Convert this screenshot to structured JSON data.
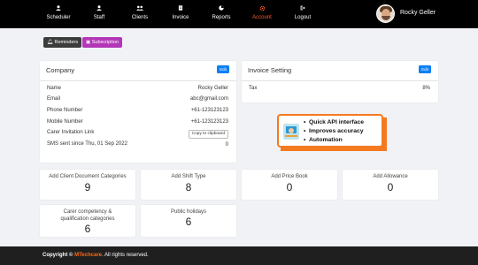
{
  "nav": {
    "items": [
      {
        "label": "Scheduler",
        "icon": "user-icon"
      },
      {
        "label": "Staff",
        "icon": "user-icon"
      },
      {
        "label": "Clients",
        "icon": "users-icon"
      },
      {
        "label": "Invoice",
        "icon": "invoice-icon"
      },
      {
        "label": "Reports",
        "icon": "chart-icon"
      },
      {
        "label": "Account",
        "icon": "gear-icon",
        "active": true
      },
      {
        "label": "Logout",
        "icon": "logout-icon"
      }
    ],
    "active_color": "#ff5a2c"
  },
  "user": {
    "name": "Rocky Geller"
  },
  "buttons": {
    "reminders": "Reminders",
    "subscription": "Subscription"
  },
  "company": {
    "title": "Company",
    "edit": "Edit",
    "rows": [
      {
        "label": "Name",
        "value": "Rocky Geller"
      },
      {
        "label": "Email",
        "value": "abc@gmail.com"
      },
      {
        "label": "Phone Number",
        "value": "+61-123123123"
      },
      {
        "label": "Mobile Number",
        "value": "+61-123123123"
      },
      {
        "label": "Carer Invitation Link",
        "value": ""
      }
    ],
    "copy_button": "Copy to clipboard",
    "sms_label": "SMS sent since Thu, 01 Sep 2022",
    "sms_value": "0"
  },
  "invoice": {
    "title": "Invoice Setting",
    "edit": "Edit",
    "tax_label": "Tax",
    "tax_value": "8%"
  },
  "promo": {
    "items": [
      "Quick API interface",
      "Improves accuracy",
      "Automation"
    ],
    "accent": "#f47a1f"
  },
  "stats": [
    {
      "label": "Add Client Document Categories",
      "value": "9"
    },
    {
      "label": "Add Shift Type",
      "value": "8"
    },
    {
      "label": "Add Price Book",
      "value": "0"
    },
    {
      "label": "Add Allowance",
      "value": "0"
    },
    {
      "label": "Carer competency & qualification categories",
      "value": "6"
    },
    {
      "label": "Public holidays",
      "value": "6"
    }
  ],
  "footer": {
    "prefix": "Copyright ©",
    "brand": "MTechcare",
    "suffix": ". All rights reserved."
  },
  "colors": {
    "topbar": "#000000",
    "edit_button": "#0d7ff4",
    "subscription": "#b336b8",
    "footer": "#1f1f1f"
  }
}
